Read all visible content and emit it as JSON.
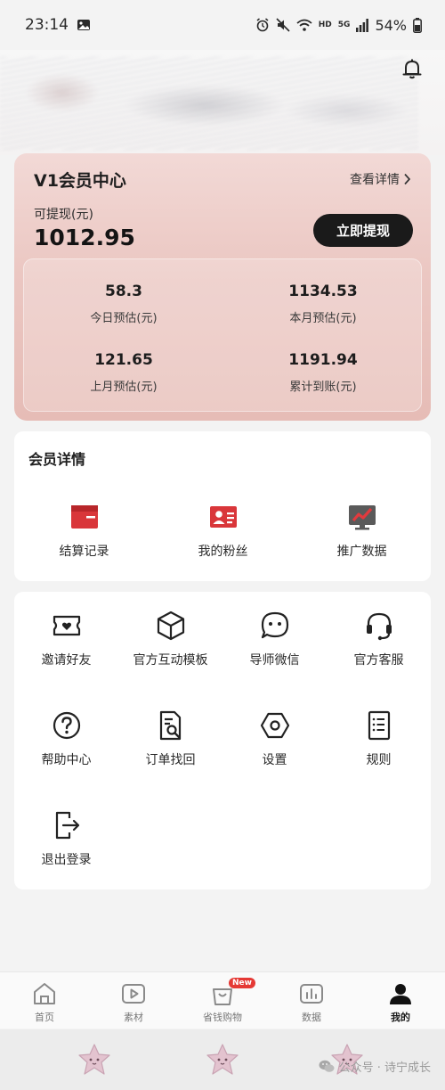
{
  "status_bar": {
    "time": "23:14",
    "net_label": "HD",
    "net_gen": "5G",
    "battery": "54%"
  },
  "member_card": {
    "title": "V1会员中心",
    "details_link": "查看详情",
    "withdrawable_label": "可提现(元)",
    "withdrawable_amount": "1012.95",
    "withdraw_button": "立即提现",
    "stats": [
      {
        "value": "58.3",
        "label": "今日预估(元)"
      },
      {
        "value": "1134.53",
        "label": "本月预估(元)"
      },
      {
        "value": "121.65",
        "label": "上月预估(元)"
      },
      {
        "value": "1191.94",
        "label": "累计到账(元)"
      }
    ]
  },
  "member_details": {
    "title": "会员详情",
    "items": [
      {
        "label": "结算记录",
        "icon": "wallet-icon"
      },
      {
        "label": "我的粉丝",
        "icon": "id-card-icon"
      },
      {
        "label": "推广数据",
        "icon": "trend-chart-icon"
      }
    ]
  },
  "tools": {
    "items": [
      {
        "label": "邀请好友",
        "icon": "ticket-heart-icon"
      },
      {
        "label": "官方互动模板",
        "icon": "cube-icon"
      },
      {
        "label": "导师微信",
        "icon": "chat-bubble-icon"
      },
      {
        "label": "官方客服",
        "icon": "headset-icon"
      },
      {
        "label": "帮助中心",
        "icon": "help-icon"
      },
      {
        "label": "订单找回",
        "icon": "document-search-icon"
      },
      {
        "label": "设置",
        "icon": "hexagon-settings-icon"
      },
      {
        "label": "规则",
        "icon": "rules-list-icon"
      },
      {
        "label": "退出登录",
        "icon": "logout-icon"
      }
    ]
  },
  "bottom_nav": {
    "items": [
      {
        "label": "首页",
        "icon": "home-icon"
      },
      {
        "label": "素材",
        "icon": "play-icon"
      },
      {
        "label": "省钱购物",
        "icon": "shopping-bag-icon",
        "badge": "New"
      },
      {
        "label": "数据",
        "icon": "bar-chart-icon"
      },
      {
        "label": "我的",
        "icon": "person-icon",
        "active": true
      }
    ]
  },
  "watermark": {
    "text": "公众号 · 诗宁成长"
  },
  "colors": {
    "card_gradient_top": "#f2d9d6",
    "card_gradient_bottom": "#e6bcb6",
    "accent_red": "#d9363a",
    "button_dark": "#1a1a1a",
    "badge_red": "#e53935"
  }
}
